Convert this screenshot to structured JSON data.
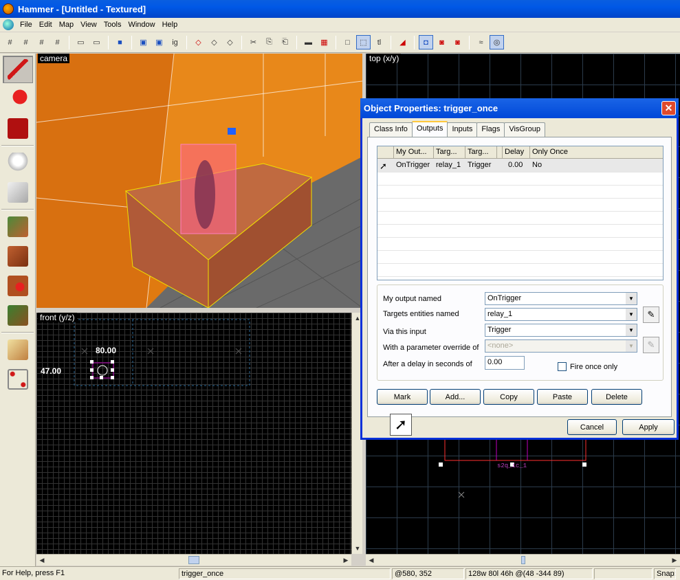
{
  "window": {
    "title": "Hammer - [Untitled - Textured]"
  },
  "menu": [
    "File",
    "Edit",
    "Map",
    "View",
    "Tools",
    "Window",
    "Help"
  ],
  "views": {
    "camera_label": "camera",
    "front_label": "front (y/z)",
    "top_label": "top (x/y)",
    "front_dim_w": "80.00",
    "front_dim_h": "47.00",
    "top_entity_text": "s2q_ic_1"
  },
  "dialog": {
    "title": "Object Properties: trigger_once",
    "tabs": [
      "Class Info",
      "Outputs",
      "Inputs",
      "Flags",
      "VisGroup"
    ],
    "active_tab": "Outputs",
    "table": {
      "headers": [
        "My Out...",
        "Targ...",
        "Targ...",
        "Delay",
        "Only Once"
      ],
      "rows": [
        {
          "output": "OnTrigger",
          "target": "relay_1",
          "input": "Trigger",
          "delay": "0.00",
          "once": "No"
        }
      ]
    },
    "form": {
      "output_label": "My output named",
      "output_value": "OnTrigger",
      "target_label": "Targets entities named",
      "target_value": "relay_1",
      "input_label": "Via this input",
      "input_value": "Trigger",
      "param_label": "With a parameter override of",
      "param_value": "<none>",
      "delay_label": "After a delay in seconds of",
      "delay_value": "0.00",
      "fire_once_label": "Fire once only"
    },
    "buttons": {
      "mark": "Mark",
      "add": "Add...",
      "copy": "Copy",
      "paste": "Paste",
      "delete": "Delete",
      "cancel": "Cancel",
      "apply": "Apply"
    }
  },
  "status": {
    "help": "For Help, press F1",
    "selection": "trigger_once",
    "coords": "@580, 352",
    "size": "128w 80l 46h @(48 -344 89)",
    "snap": "Snap:"
  }
}
